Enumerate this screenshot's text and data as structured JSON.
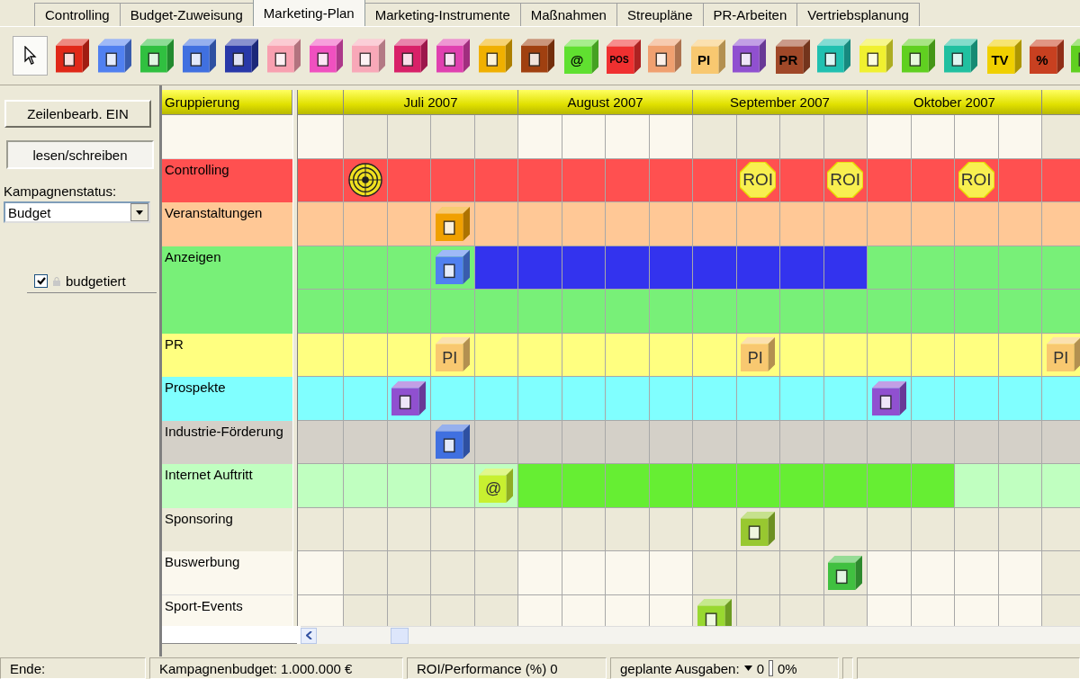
{
  "tabs": [
    {
      "label": "Controlling",
      "selected": false
    },
    {
      "label": "Budget-Zuweisung",
      "selected": false
    },
    {
      "label": "Marketing-Plan",
      "selected": true
    },
    {
      "label": "Marketing-Instrumente",
      "selected": false
    },
    {
      "label": "Maßnahmen",
      "selected": false
    },
    {
      "label": "Streupläne",
      "selected": false
    },
    {
      "label": "PR-Arbeiten",
      "selected": false
    },
    {
      "label": "Vertriebsplanung",
      "selected": false
    }
  ],
  "toolbar": [
    {
      "kind": "pointer",
      "selected": true
    },
    {
      "kind": "cube",
      "color": "#e02818",
      "selected": false
    },
    {
      "kind": "cube",
      "color": "#5080f0",
      "selected": false
    },
    {
      "kind": "cube",
      "color": "#30c040",
      "selected": false
    },
    {
      "kind": "cube",
      "color": "#4070e0",
      "selected": false
    },
    {
      "kind": "cube",
      "color": "#2838a8",
      "selected": false
    },
    {
      "kind": "cube",
      "color": "#f8a0b0",
      "selected": false
    },
    {
      "kind": "cube",
      "color": "#f050c0",
      "selected": false
    },
    {
      "kind": "cube",
      "color": "#f8a8b8",
      "selected": false
    },
    {
      "kind": "cube",
      "color": "#d82068",
      "selected": false
    },
    {
      "kind": "cube",
      "color": "#e040b0",
      "selected": false
    },
    {
      "kind": "cube",
      "color": "#f0b000",
      "selected": false
    },
    {
      "kind": "cube",
      "color": "#a04010",
      "selected": false
    },
    {
      "kind": "cube",
      "color": "#60e030",
      "label": "@",
      "selected": false
    },
    {
      "kind": "cube",
      "color": "#f03030",
      "label": "POS",
      "selected": false
    },
    {
      "kind": "cube",
      "color": "#f0a070",
      "selected": false
    },
    {
      "kind": "cube",
      "color": "#f8c870",
      "label": "PI",
      "selected": false
    },
    {
      "kind": "cube",
      "color": "#9050d0",
      "selected": false
    },
    {
      "kind": "cube",
      "color": "#a04828",
      "label": "PR",
      "selected": false
    },
    {
      "kind": "cube",
      "color": "#20c0b0",
      "selected": false
    },
    {
      "kind": "cube",
      "color": "#f0f030",
      "selected": false
    },
    {
      "kind": "cube",
      "color": "#60d020",
      "selected": false
    },
    {
      "kind": "cube",
      "color": "#20c0a0",
      "selected": false
    },
    {
      "kind": "cube",
      "color": "#f0d000",
      "label": "TV",
      "selected": false
    },
    {
      "kind": "cube",
      "color": "#c84020",
      "label": "%",
      "selected": false
    },
    {
      "kind": "cube",
      "color": "#60d020",
      "selected": false
    }
  ],
  "side_panel": {
    "edit_button": "Zeilenbearb. EIN",
    "mode": "lesen/schreiben",
    "status_label": "Kampagnenstatus:",
    "status_value": "Budget",
    "budgeted": {
      "label": "budgetiert",
      "checked": true
    }
  },
  "plan": {
    "group_header": "Gruppierung",
    "months": [
      {
        "label": "Juli 2007"
      },
      {
        "label": "August 2007"
      },
      {
        "label": "September 2007"
      },
      {
        "label": "Oktober 2007"
      }
    ],
    "rows": [
      {
        "cells": [
          {
            "kind": "empty"
          },
          {
            "kind": "empty"
          },
          {
            "kind": "empty"
          },
          {
            "kind": "empty"
          },
          {
            "kind": "empty"
          },
          {
            "kind": "empty"
          },
          {
            "kind": "empty"
          },
          {
            "kind": "empty"
          },
          {
            "kind": "empty"
          },
          {
            "kind": "empty"
          },
          {
            "kind": "empty"
          },
          {
            "kind": "empty"
          },
          {
            "kind": "empty"
          },
          {
            "kind": "empty"
          },
          {
            "kind": "empty"
          },
          {
            "kind": "empty"
          },
          {
            "kind": "empty"
          },
          {
            "kind": "empty"
          }
        ]
      },
      {
        "label": "Controlling",
        "color": "#ff5050",
        "cells": [
          {
            "kind": "empty"
          },
          {
            "kind": "target"
          },
          {
            "kind": "empty"
          },
          {
            "kind": "empty"
          },
          {
            "kind": "empty"
          },
          {
            "kind": "empty"
          },
          {
            "kind": "empty"
          },
          {
            "kind": "empty"
          },
          {
            "kind": "empty"
          },
          {
            "kind": "empty"
          },
          {
            "kind": "roi",
            "label": "ROI"
          },
          {
            "kind": "empty"
          },
          {
            "kind": "roi",
            "label": "ROI"
          },
          {
            "kind": "empty"
          },
          {
            "kind": "empty"
          },
          {
            "kind": "roi",
            "label": "ROI"
          },
          {
            "kind": "empty"
          },
          {
            "kind": "empty"
          }
        ]
      },
      {
        "label": "Veranstaltungen",
        "color": "#ffc896",
        "cells": [
          {
            "kind": "empty"
          },
          {
            "kind": "empty"
          },
          {
            "kind": "empty"
          },
          {
            "kind": "cube",
            "color": "#f0a000"
          },
          {
            "kind": "empty"
          },
          {
            "kind": "empty"
          },
          {
            "kind": "empty"
          },
          {
            "kind": "empty"
          },
          {
            "kind": "empty"
          },
          {
            "kind": "empty"
          },
          {
            "kind": "empty"
          },
          {
            "kind": "empty"
          },
          {
            "kind": "empty"
          },
          {
            "kind": "empty"
          },
          {
            "kind": "empty"
          },
          {
            "kind": "empty"
          },
          {
            "kind": "empty"
          },
          {
            "kind": "empty"
          }
        ]
      },
      {
        "label": "Anzeigen",
        "color": "#78f078",
        "bar": {
          "color": "#3333ee"
        },
        "cells": [
          {
            "kind": "empty"
          },
          {
            "kind": "empty"
          },
          {
            "kind": "empty"
          },
          {
            "kind": "cube",
            "color": "#5080f0"
          },
          {
            "kind": "bar"
          },
          {
            "kind": "bar"
          },
          {
            "kind": "bar"
          },
          {
            "kind": "bar"
          },
          {
            "kind": "bar"
          },
          {
            "kind": "bar"
          },
          {
            "kind": "bar"
          },
          {
            "kind": "bar"
          },
          {
            "kind": "bar"
          },
          {
            "kind": "empty"
          },
          {
            "kind": "empty"
          },
          {
            "kind": "empty"
          },
          {
            "kind": "empty"
          },
          {
            "kind": "empty"
          }
        ]
      },
      {
        "color": "#78f078",
        "cells": [
          {
            "kind": "empty"
          },
          {
            "kind": "empty"
          },
          {
            "kind": "empty"
          },
          {
            "kind": "empty"
          },
          {
            "kind": "empty"
          },
          {
            "kind": "empty"
          },
          {
            "kind": "empty"
          },
          {
            "kind": "empty"
          },
          {
            "kind": "empty"
          },
          {
            "kind": "empty"
          },
          {
            "kind": "empty"
          },
          {
            "kind": "empty"
          },
          {
            "kind": "empty"
          },
          {
            "kind": "empty"
          },
          {
            "kind": "empty"
          },
          {
            "kind": "empty"
          },
          {
            "kind": "empty"
          },
          {
            "kind": "empty"
          }
        ]
      },
      {
        "label": "PR",
        "color": "#ffff80",
        "cells": [
          {
            "kind": "empty"
          },
          {
            "kind": "empty"
          },
          {
            "kind": "empty"
          },
          {
            "kind": "cube",
            "color": "#f8c870",
            "label": "PI"
          },
          {
            "kind": "empty"
          },
          {
            "kind": "empty"
          },
          {
            "kind": "empty"
          },
          {
            "kind": "empty"
          },
          {
            "kind": "empty"
          },
          {
            "kind": "empty"
          },
          {
            "kind": "cube",
            "color": "#f8c870",
            "label": "PI"
          },
          {
            "kind": "empty"
          },
          {
            "kind": "empty"
          },
          {
            "kind": "empty"
          },
          {
            "kind": "empty"
          },
          {
            "kind": "empty"
          },
          {
            "kind": "empty"
          },
          {
            "kind": "cube",
            "color": "#f8c870",
            "label": "PI"
          }
        ]
      },
      {
        "label": "Prospekte",
        "color": "#80ffff",
        "cells": [
          {
            "kind": "empty"
          },
          {
            "kind": "empty"
          },
          {
            "kind": "cube",
            "color": "#9050d0"
          },
          {
            "kind": "empty"
          },
          {
            "kind": "empty"
          },
          {
            "kind": "empty"
          },
          {
            "kind": "empty"
          },
          {
            "kind": "empty"
          },
          {
            "kind": "empty"
          },
          {
            "kind": "empty"
          },
          {
            "kind": "empty"
          },
          {
            "kind": "empty"
          },
          {
            "kind": "empty"
          },
          {
            "kind": "cube",
            "color": "#9050d0"
          },
          {
            "kind": "empty"
          },
          {
            "kind": "empty"
          },
          {
            "kind": "empty"
          },
          {
            "kind": "empty"
          }
        ]
      },
      {
        "label": "Industrie-Förderung",
        "color": "#d4d0c8",
        "cells": [
          {
            "kind": "empty"
          },
          {
            "kind": "empty"
          },
          {
            "kind": "empty"
          },
          {
            "kind": "cube",
            "color": "#4070e0"
          },
          {
            "kind": "empty"
          },
          {
            "kind": "empty"
          },
          {
            "kind": "empty"
          },
          {
            "kind": "empty"
          },
          {
            "kind": "empty"
          },
          {
            "kind": "empty"
          },
          {
            "kind": "empty"
          },
          {
            "kind": "empty"
          },
          {
            "kind": "empty"
          },
          {
            "kind": "empty"
          },
          {
            "kind": "empty"
          },
          {
            "kind": "empty"
          },
          {
            "kind": "empty"
          },
          {
            "kind": "empty"
          }
        ]
      },
      {
        "label": "Internet Auftritt",
        "color": "#c0ffc0",
        "bar": {
          "color": "#66ee33"
        },
        "cells": [
          {
            "kind": "empty"
          },
          {
            "kind": "empty"
          },
          {
            "kind": "empty"
          },
          {
            "kind": "empty"
          },
          {
            "kind": "cube",
            "color": "#c8f030",
            "label": "@"
          },
          {
            "kind": "bar"
          },
          {
            "kind": "bar"
          },
          {
            "kind": "bar"
          },
          {
            "kind": "bar"
          },
          {
            "kind": "bar"
          },
          {
            "kind": "bar"
          },
          {
            "kind": "bar"
          },
          {
            "kind": "bar"
          },
          {
            "kind": "bar"
          },
          {
            "kind": "bar"
          },
          {
            "kind": "empty"
          },
          {
            "kind": "empty"
          },
          {
            "kind": "empty"
          }
        ]
      },
      {
        "label": "Sponsoring",
        "color": "#ece9d8",
        "cells": [
          {
            "kind": "empty"
          },
          {
            "kind": "empty"
          },
          {
            "kind": "empty"
          },
          {
            "kind": "empty"
          },
          {
            "kind": "empty"
          },
          {
            "kind": "empty"
          },
          {
            "kind": "empty"
          },
          {
            "kind": "empty"
          },
          {
            "kind": "empty"
          },
          {
            "kind": "empty"
          },
          {
            "kind": "cube",
            "color": "#98c830"
          },
          {
            "kind": "empty"
          },
          {
            "kind": "empty"
          },
          {
            "kind": "empty"
          },
          {
            "kind": "empty"
          },
          {
            "kind": "empty"
          },
          {
            "kind": "empty"
          },
          {
            "kind": "empty"
          }
        ]
      },
      {
        "label": "Buswerbung",
        "cells": [
          {
            "kind": "empty"
          },
          {
            "kind": "empty"
          },
          {
            "kind": "empty"
          },
          {
            "kind": "empty"
          },
          {
            "kind": "empty"
          },
          {
            "kind": "empty"
          },
          {
            "kind": "empty"
          },
          {
            "kind": "empty"
          },
          {
            "kind": "empty"
          },
          {
            "kind": "empty"
          },
          {
            "kind": "empty"
          },
          {
            "kind": "empty"
          },
          {
            "kind": "cube",
            "color": "#40c040"
          },
          {
            "kind": "empty"
          },
          {
            "kind": "empty"
          },
          {
            "kind": "empty"
          },
          {
            "kind": "empty"
          },
          {
            "kind": "empty"
          }
        ]
      },
      {
        "label": "Sport-Events",
        "cells": [
          {
            "kind": "empty"
          },
          {
            "kind": "empty"
          },
          {
            "kind": "empty"
          },
          {
            "kind": "empty"
          },
          {
            "kind": "empty"
          },
          {
            "kind": "empty"
          },
          {
            "kind": "empty"
          },
          {
            "kind": "empty"
          },
          {
            "kind": "empty"
          },
          {
            "kind": "cube",
            "color": "#98d830"
          },
          {
            "kind": "empty"
          },
          {
            "kind": "empty"
          },
          {
            "kind": "empty"
          },
          {
            "kind": "empty"
          },
          {
            "kind": "empty"
          },
          {
            "kind": "empty"
          },
          {
            "kind": "empty"
          },
          {
            "kind": "empty"
          }
        ]
      }
    ]
  },
  "status_bar": {
    "end": "Ende:",
    "budget": "Kampagnenbudget: 1.000.000 €",
    "roi": "ROI/Performance (%) 0",
    "planned_label": "geplante Ausgaben:",
    "planned_value": "0",
    "planned_percent": "0%"
  }
}
